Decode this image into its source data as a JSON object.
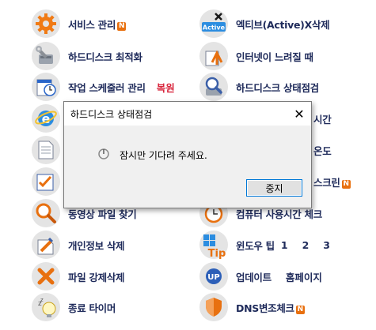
{
  "menu_left": [
    {
      "label": "서비스 관리",
      "badge": "N",
      "icon": "gear-icon"
    },
    {
      "label": "하드디스크 최적화",
      "icon": "wrench-disk-icon"
    },
    {
      "label": "작업 스케줄러 관리",
      "extra": "복원",
      "extra_color": "#d8233a",
      "icon": "clock-icon"
    },
    {
      "label": "",
      "icon": "ie-browser-icon"
    },
    {
      "label": "",
      "icon": "document-icon"
    },
    {
      "label": "",
      "icon": "checklist-icon"
    },
    {
      "label": "동영상 파일 찾기",
      "icon": "magnifier-icon"
    },
    {
      "label": "개인정보 삭제",
      "icon": "eraser-icon"
    },
    {
      "label": "파일 강제삭제",
      "icon": "x-delete-icon"
    },
    {
      "label": "종료 타이머",
      "icon": "sleep-bulb-icon"
    }
  ],
  "menu_right": [
    {
      "label": "엑티브(Active)X삭제",
      "icon": "activex-icon"
    },
    {
      "label": "인터넷이 느려질 때",
      "icon": "upload-arrow-icon"
    },
    {
      "label": "하드디스크 상태점검",
      "icon": "disk-check-icon"
    },
    {
      "label": "시간",
      "icon": "time-icon"
    },
    {
      "label": "온도",
      "icon": "temperature-icon"
    },
    {
      "label": "스크린",
      "badge": "N",
      "icon": "screen-icon"
    },
    {
      "label": "컴퓨터 사용시간 체크",
      "icon": "timer-clock-icon"
    },
    {
      "label": "윈도우 팁",
      "links": [
        "1",
        "2",
        "3"
      ],
      "icon": "tip-icon"
    },
    {
      "label": "업데이트",
      "extra": "홈페이지",
      "extra_color": "#1e2a5a",
      "icon": "update-icon"
    },
    {
      "label": "DNS변조체크",
      "badge": "N",
      "icon": "shield-icon"
    }
  ],
  "dialog": {
    "title": "하드디스크 상태점검",
    "close_glyph": "✕",
    "message": "잠시만 기다려 주세요.",
    "stop_label": "중지"
  },
  "colors": {
    "label_text": "#1e2a5a",
    "badge": "#e8700f",
    "restore_red": "#d8233a",
    "dialog_bg": "#f0f0f0",
    "button_border": "#0078d7"
  }
}
